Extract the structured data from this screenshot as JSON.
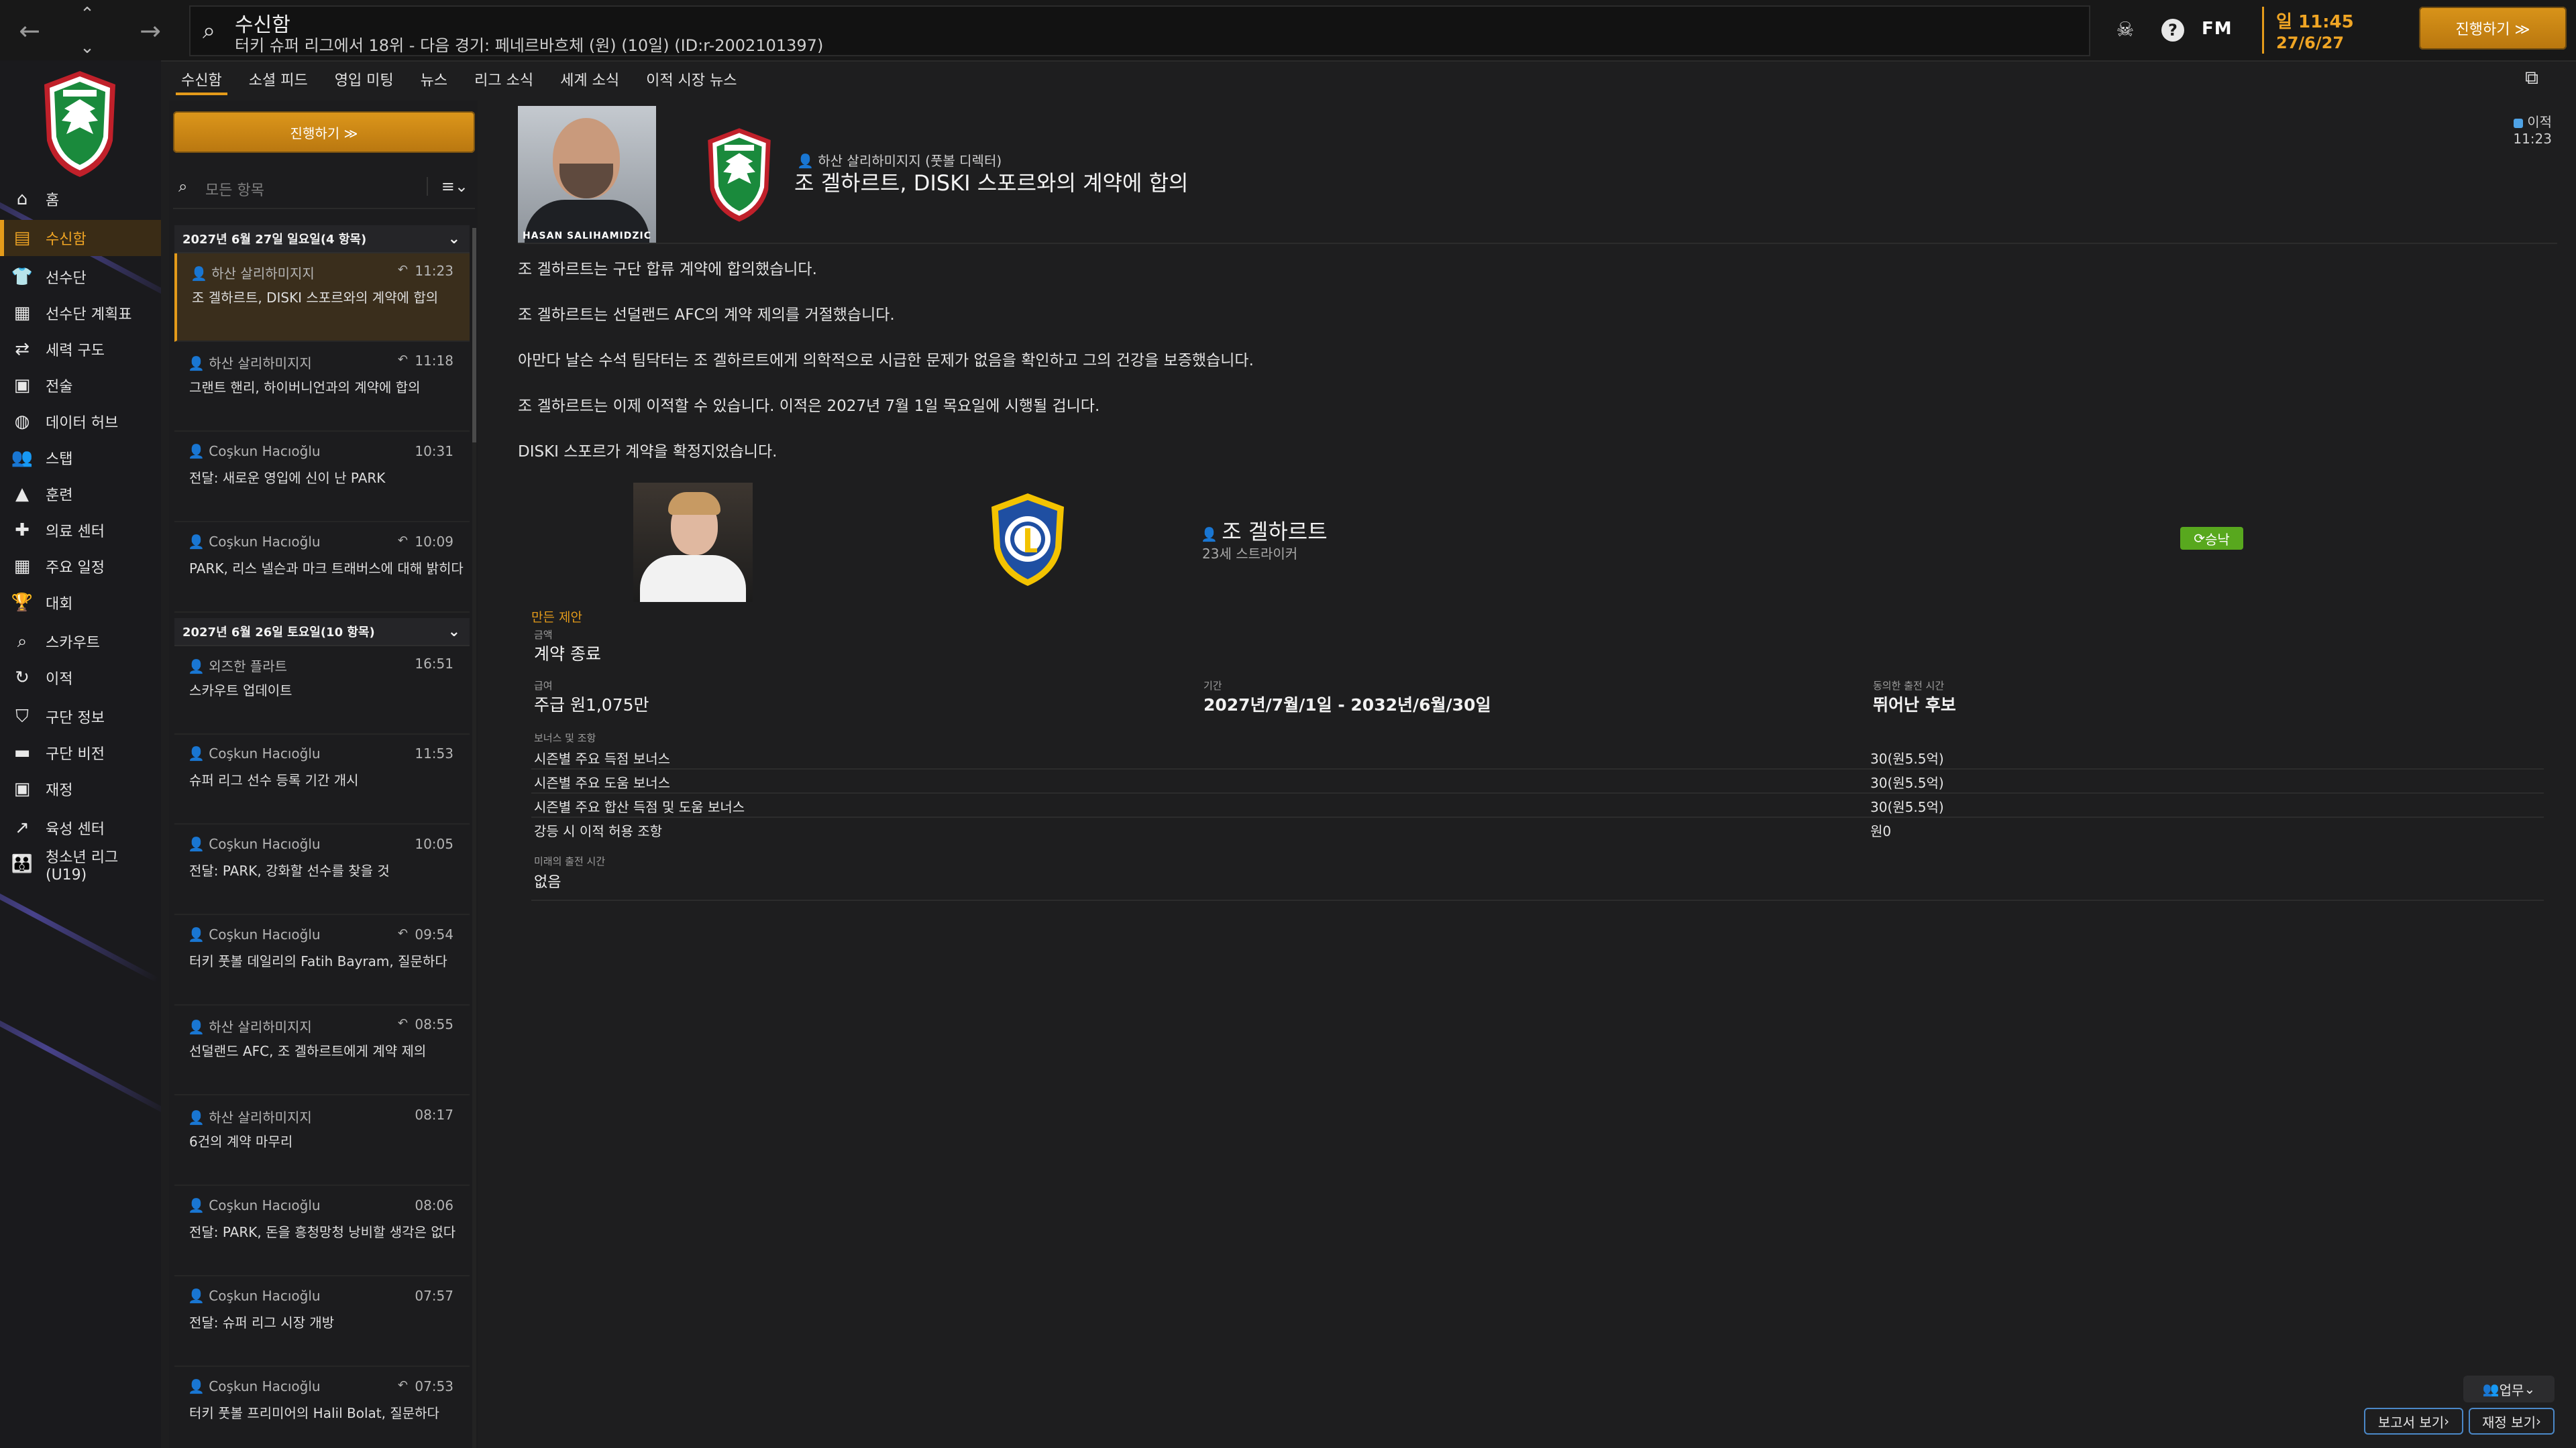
{
  "topbar": {
    "title": "수신함",
    "subtitle": "터키 슈퍼 리그에서 18위 - 다음 경기: 페네르바흐체 (원) (10일) (ID:r-2002101397)",
    "fm_logo": "FM",
    "time": "일 11:45",
    "date": "27/6/27",
    "continue_label": "진행하기 ≫"
  },
  "sidebar": {
    "items": [
      {
        "label": "홈",
        "icon": "home-icon"
      },
      {
        "label": "수신함",
        "icon": "inbox-icon"
      },
      {
        "label": "선수단",
        "icon": "shirt-icon"
      },
      {
        "label": "선수단 계획표",
        "icon": "clipboard-icon"
      },
      {
        "label": "세력 구도",
        "icon": "dynamics-icon"
      },
      {
        "label": "전술",
        "icon": "tactics-icon"
      },
      {
        "label": "데이터 허브",
        "icon": "data-hub-icon"
      },
      {
        "label": "스탭",
        "icon": "staff-icon"
      },
      {
        "label": "훈련",
        "icon": "training-icon"
      },
      {
        "label": "의료 센터",
        "icon": "medical-icon"
      },
      {
        "label": "주요 일정",
        "icon": "calendar-icon"
      },
      {
        "label": "대회",
        "icon": "trophy-icon"
      },
      {
        "label": "스카우트",
        "icon": "scouting-icon"
      },
      {
        "label": "이적",
        "icon": "transfers-icon"
      },
      {
        "label": "구단 정보",
        "icon": "club-info-icon"
      },
      {
        "label": "구단 비전",
        "icon": "club-vision-icon"
      },
      {
        "label": "재정",
        "icon": "finances-icon"
      },
      {
        "label": "육성 센터",
        "icon": "development-icon"
      },
      {
        "label": "청소년 리그 (U19)",
        "icon": "youth-icon"
      }
    ]
  },
  "tabs": [
    "수신함",
    "소셜 피드",
    "영입 미팅",
    "뉴스",
    "리그 소식",
    "세계 소식",
    "이적 시장 뉴스"
  ],
  "inbox": {
    "continue_label": "진행하기 ≫",
    "filter_placeholder": "모든 항목",
    "groups": [
      {
        "header": "2027년 6월 27일 일요일(4 항목)",
        "messages": [
          {
            "sender": "하산 살리하미지지",
            "time": "11:23",
            "subject": "조 겔하르트, DISKI 스포르와의 계약에 합의",
            "reply": true
          },
          {
            "sender": "하산 살리하미지지",
            "time": "11:18",
            "subject": "그랜트 핸리, 하이버니언과의 계약에 합의",
            "reply": true
          },
          {
            "sender": "Coşkun Hacıoğlu",
            "time": "10:31",
            "subject": "전달: 새로운 영입에 신이 난 PARK",
            "reply": false
          },
          {
            "sender": "Coşkun Hacıoğlu",
            "time": "10:09",
            "subject": "PARK, 리스 넬슨과 마크 트래버스에 대해 밝히다",
            "reply": true
          }
        ]
      },
      {
        "header": "2027년 6월 26일 토요일(10 항목)",
        "messages": [
          {
            "sender": "외즈한 플라트",
            "time": "16:51",
            "subject": "스카우트 업데이트",
            "reply": false
          },
          {
            "sender": "Coşkun Hacıoğlu",
            "time": "11:53",
            "subject": "슈퍼 리그 선수 등록 기간 개시",
            "reply": false
          },
          {
            "sender": "Coşkun Hacıoğlu",
            "time": "10:05",
            "subject": "전달: PARK, 강화할 선수를 찾을 것",
            "reply": false
          },
          {
            "sender": "Coşkun Hacıoğlu",
            "time": "09:54",
            "subject": "터키 풋볼 데일리의 Fatih Bayram, 질문하다",
            "reply": true
          },
          {
            "sender": "하산 살리하미지지",
            "time": "08:55",
            "subject": "선덜랜드 AFC, 조 겔하르트에게 계약 제의",
            "reply": true
          },
          {
            "sender": "하산 살리하미지지",
            "time": "08:17",
            "subject": "6건의 계약 마무리",
            "reply": false
          },
          {
            "sender": "Coşkun Hacıoğlu",
            "time": "08:06",
            "subject": "전달: PARK, 돈을 흥청망청 낭비할 생각은 없다",
            "reply": false
          },
          {
            "sender": "Coşkun Hacıoğlu",
            "time": "07:57",
            "subject": "전달: 슈퍼 리그 시장 개방",
            "reply": false
          },
          {
            "sender": "Coşkun Hacıoğlu",
            "time": "07:53",
            "subject": "터키 풋볼 프리미어의 Halil Bolat, 질문하다",
            "reply": true
          }
        ]
      }
    ]
  },
  "message": {
    "sender_photo_caption": "HASAN SALIHAMIDZIC",
    "from": "하산 살리하미지지 (풋볼 디렉터)",
    "title": "조 겔하르트, DISKI 스포르와의 계약에 합의",
    "tag": "이적",
    "tag_time": "11:23",
    "paragraphs": [
      "조 겔하르트는 구단 합류 계약에 합의했습니다.",
      "조 겔하르트는 선덜랜드 AFC의 계약 제의를 거절했습니다.",
      "아만다 날슨 수석 팀닥터는 조 겔하르트에게 의학적으로 시급한 문제가 없음을 확인하고 그의 건강을 보증했습니다.",
      "조 겔하르트는 이제 이적할 수 있습니다. 이적은 2027년 7월 1일 목요일에 시행될 겁니다.",
      "DISKI 스포르가 계약을 확정지었습니다."
    ],
    "player_name": "조 겔하르트",
    "player_desc": "23세 스트라이커",
    "accept_label": "승낙",
    "offer_label": "만든 제안",
    "fee_label": "금액",
    "fee_value": "계약 종료",
    "wage_label": "급여",
    "wage_value": "주급 원1,075만",
    "period_label": "기간",
    "period_value": "2027년/7월/1일 - 2032년/6월/30일",
    "playtime_label": "동의한 출전 시간",
    "playtime_value": "뛰어난 후보",
    "bonus_label": "보너스 및 조항",
    "bonuses": [
      {
        "name": "시즌별 주요 득점 보너스",
        "value": "30(원5.5억)"
      },
      {
        "name": "시즌별 주요 도움 보너스",
        "value": "30(원5.5억)"
      },
      {
        "name": "시즌별 주요 합산 득점 및 도움 보너스",
        "value": "30(원5.5억)"
      },
      {
        "name": "강등 시 이적 허용 조항",
        "value": "원0"
      }
    ],
    "future_label": "미래의 출전 시간",
    "future_value": "없음"
  },
  "footer": {
    "work_label": "업무",
    "report_label": "보고서 보기",
    "finance_label": "재정 보기"
  },
  "colors": {
    "accent": "#e49b1a",
    "accept": "#58a81e",
    "background": "#1e1e1f"
  }
}
